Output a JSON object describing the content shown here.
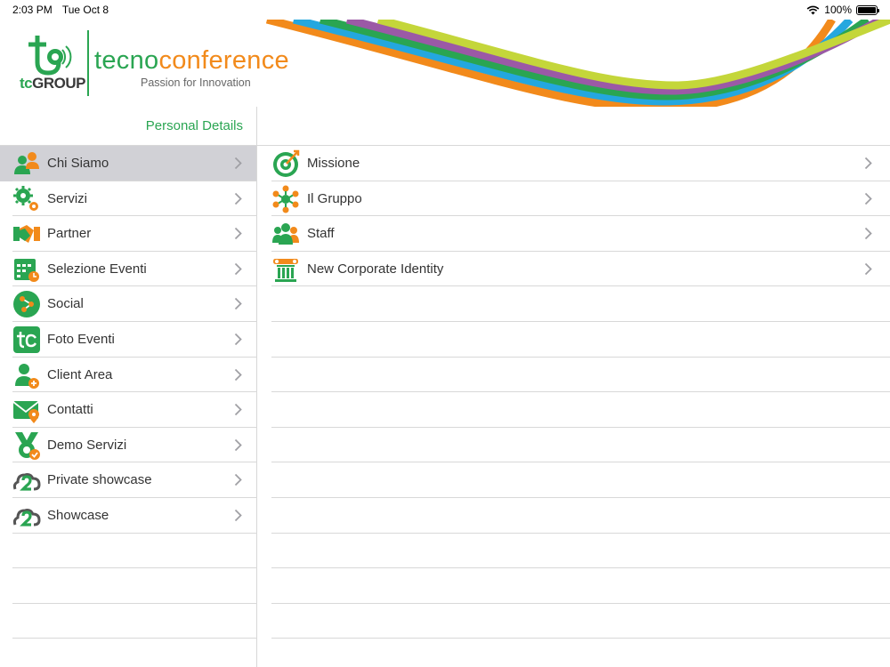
{
  "status_bar": {
    "time": "2:03 PM",
    "date": "Tue Oct 8",
    "battery": "100%",
    "battery_level": 1.0
  },
  "header": {
    "group_logo_prefix": "tc",
    "group_logo_suffix": "GROUP",
    "brand_part1": "tecno",
    "brand_part2": "conference",
    "tagline": "Passion for Innovation"
  },
  "left": {
    "personal_details": "Personal Details",
    "items": [
      {
        "label": "Chi Siamo",
        "icon": "people-icon",
        "selected": true
      },
      {
        "label": "Servizi",
        "icon": "gears-icon"
      },
      {
        "label": "Partner",
        "icon": "handshake-icon"
      },
      {
        "label": "Selezione Eventi",
        "icon": "calendar-icon"
      },
      {
        "label": "Social",
        "icon": "share-icon"
      },
      {
        "label": "Foto Eventi",
        "icon": "tc-logo-icon"
      },
      {
        "label": "Client Area",
        "icon": "user-add-icon"
      },
      {
        "label": "Contatti",
        "icon": "mail-location-icon"
      },
      {
        "label": "Demo Servizi",
        "icon": "badge-check-icon"
      },
      {
        "label": "Private showcase",
        "icon": "cloud-icon"
      },
      {
        "label": "Showcase",
        "icon": "cloud-icon"
      }
    ]
  },
  "right": {
    "items": [
      {
        "label": "Missione",
        "icon": "target-icon"
      },
      {
        "label": "Il Gruppo",
        "icon": "group-network-icon"
      },
      {
        "label": "Staff",
        "icon": "staff-icon"
      },
      {
        "label": "New Corporate Identity",
        "icon": "column-icon"
      }
    ]
  },
  "colors": {
    "brand_green": "#2aa552",
    "brand_orange": "#f28a1b",
    "selected_bg": "#d1d1d6"
  }
}
